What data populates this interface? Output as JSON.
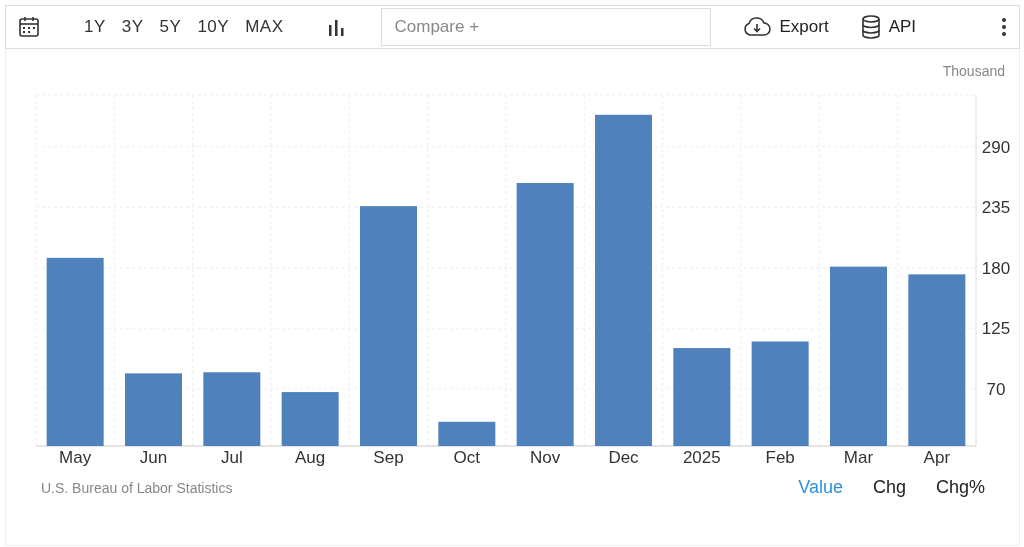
{
  "toolbar": {
    "ranges": [
      "1Y",
      "3Y",
      "5Y",
      "10Y",
      "MAX"
    ],
    "compare": {
      "placeholder": "Compare +"
    },
    "export": "Export",
    "api": "API"
  },
  "unit": "Thousand",
  "chart_data": {
    "type": "bar",
    "categories": [
      "May",
      "Jun",
      "Jul",
      "Aug",
      "Sep",
      "Oct",
      "Nov",
      "Dec",
      "2025",
      "Feb",
      "Mar",
      "Apr"
    ],
    "series": [
      {
        "color": "#4f81bd",
        "values": [
          189,
          84,
          85,
          67,
          236,
          40,
          257,
          319,
          107,
          113,
          181,
          174
        ]
      }
    ],
    "ylim": [
      18,
      337
    ],
    "grid": true,
    "yticks": [
      70,
      125,
      180,
      235,
      290
    ]
  },
  "source": "U.S. Bureau of Labor Statistics",
  "views": [
    {
      "label": "Value",
      "selected": true
    },
    {
      "label": "Chg",
      "selected": false
    },
    {
      "label": "Chg%",
      "selected": false
    }
  ]
}
